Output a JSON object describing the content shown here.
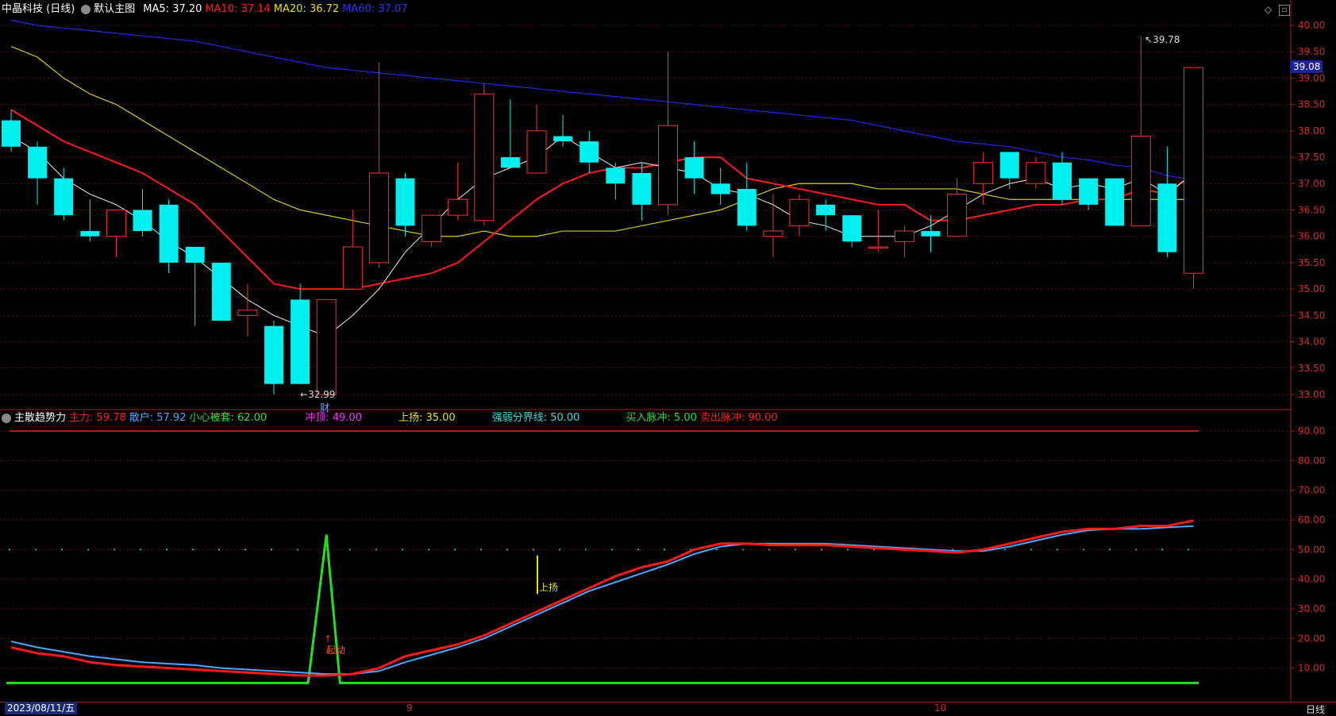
{
  "main_header": {
    "stock": "中晶科技 (日线)",
    "template": "默认主图",
    "ma5": {
      "label": "MA5: 37.20",
      "color": "#ffffff"
    },
    "ma10": {
      "label": "MA10: 37.14",
      "color": "#ff2020"
    },
    "ma20": {
      "label": "MA20: 36.72",
      "color": "#e8e000"
    },
    "ma60": {
      "label": "MA60: 37.07",
      "color": "#3030ff"
    }
  },
  "sub_header": {
    "title": "主散趋势力",
    "items": [
      {
        "label": "主力: 59.78",
        "color": "#ff2020"
      },
      {
        "label": "散户: 57.92",
        "color": "#4aa8ff"
      },
      {
        "label": "小心被套: 62.00",
        "color": "#30e030"
      },
      {
        "label": "冲顶: 49.00",
        "color": "#ff30ff"
      },
      {
        "label": "上扬: 35.00",
        "color": "#e8e000"
      },
      {
        "label": "强弱分界线: 50.00",
        "color": "#30e0e0"
      },
      {
        "label": "买入脉冲: 5.00",
        "color": "#30e030"
      },
      {
        "label": "卖出脉冲: 90.00",
        "color": "#ff2020"
      }
    ]
  },
  "price_axis": [
    "40.00",
    "39.50",
    "39.00",
    "38.50",
    "38.00",
    "37.50",
    "37.00",
    "36.50",
    "36.00",
    "35.50",
    "35.00",
    "34.50",
    "34.00",
    "33.50",
    "33.00"
  ],
  "indicator_axis": [
    "90.00",
    "80.00",
    "70.00",
    "60.00",
    "50.00",
    "40.00",
    "30.00",
    "20.00",
    "10.00"
  ],
  "current_price_flag": "39.08",
  "max_label": "39.78",
  "min_label": "32.99",
  "event_marker": "财",
  "signal_labels": {
    "start": "起动",
    "rise": "上扬"
  },
  "bottom_bar": {
    "date": "2023/08/11/五",
    "month1": "9",
    "month2": "10",
    "period": "日线"
  },
  "chart_data": {
    "type": "candlestick",
    "ylim": [
      32.8,
      40.2
    ],
    "candles": [
      [
        38.2,
        37.7,
        38.4,
        37.6
      ],
      [
        37.7,
        37.1,
        37.8,
        36.6
      ],
      [
        37.1,
        36.4,
        37.3,
        36.3
      ],
      [
        36.1,
        36.0,
        36.7,
        35.9
      ],
      [
        36.0,
        36.5,
        36.5,
        35.6
      ],
      [
        36.5,
        36.1,
        36.9,
        36.0
      ],
      [
        36.6,
        35.5,
        36.7,
        35.3
      ],
      [
        35.8,
        35.5,
        35.8,
        34.3
      ],
      [
        35.5,
        34.4,
        35.5,
        34.4
      ],
      [
        34.5,
        34.6,
        35.1,
        34.1
      ],
      [
        34.3,
        33.2,
        34.4,
        33.0
      ],
      [
        34.8,
        33.2,
        35.1,
        33.2
      ],
      [
        33.0,
        34.8,
        34.8,
        32.99
      ],
      [
        35.0,
        35.8,
        36.5,
        35.0
      ],
      [
        35.5,
        37.2,
        39.3,
        35.4
      ],
      [
        37.1,
        36.2,
        37.2,
        36.0
      ],
      [
        35.9,
        36.4,
        36.4,
        35.8
      ],
      [
        36.4,
        36.7,
        37.4,
        36.3
      ],
      [
        36.3,
        38.7,
        38.9,
        36.2
      ],
      [
        37.5,
        37.3,
        38.6,
        37.3
      ],
      [
        37.2,
        38.0,
        38.5,
        37.2
      ],
      [
        37.9,
        37.8,
        38.3,
        37.7
      ],
      [
        37.8,
        37.4,
        38.0,
        37.2
      ],
      [
        37.3,
        37.0,
        37.4,
        36.7
      ],
      [
        37.2,
        36.6,
        37.4,
        36.3
      ],
      [
        36.6,
        38.1,
        39.5,
        36.4
      ],
      [
        37.5,
        37.1,
        37.8,
        36.8
      ],
      [
        37.0,
        36.8,
        37.3,
        36.6
      ],
      [
        36.9,
        36.2,
        37.4,
        36.1
      ],
      [
        36.0,
        36.1,
        36.8,
        35.6
      ],
      [
        36.2,
        36.7,
        36.8,
        36.0
      ],
      [
        36.6,
        36.4,
        36.7,
        36.1
      ],
      [
        36.4,
        35.9,
        36.4,
        35.8
      ],
      [
        35.8,
        35.8,
        36.5,
        35.7
      ],
      [
        35.9,
        36.1,
        36.2,
        35.6
      ],
      [
        36.1,
        36.0,
        36.4,
        35.7
      ],
      [
        36.0,
        36.8,
        37.1,
        36.0
      ],
      [
        37.0,
        37.4,
        37.6,
        36.6
      ],
      [
        37.6,
        37.1,
        37.6,
        36.9
      ],
      [
        37.0,
        37.4,
        37.5,
        36.9
      ],
      [
        37.4,
        36.7,
        37.6,
        36.6
      ],
      [
        37.1,
        36.6,
        37.1,
        36.5
      ],
      [
        37.1,
        36.2,
        37.1,
        36.2
      ],
      [
        36.2,
        37.9,
        39.8,
        36.2
      ],
      [
        37.0,
        35.7,
        37.7,
        35.6
      ],
      [
        35.3,
        39.2,
        39.2,
        35.0
      ]
    ],
    "ma5": [
      37.9,
      37.6,
      37.1,
      36.8,
      36.6,
      36.3,
      35.9,
      35.6,
      35.2,
      34.8,
      34.5,
      34.3,
      34.1,
      34.5,
      35.0,
      35.7,
      36.2,
      36.7,
      37.1,
      37.3,
      37.5,
      37.9,
      37.6,
      37.3,
      37.4,
      37.3,
      37.2,
      36.9,
      36.8,
      36.6,
      36.3,
      36.2,
      36.0,
      36.0,
      36.0,
      36.2,
      36.5,
      36.8,
      37.0,
      37.1,
      36.9,
      37.0,
      36.9,
      37.1,
      36.8,
      37.2
    ],
    "ma10": [
      38.4,
      38.1,
      37.8,
      37.6,
      37.4,
      37.2,
      36.9,
      36.6,
      36.1,
      35.6,
      35.1,
      35.0,
      35.0,
      35.0,
      35.1,
      35.2,
      35.3,
      35.5,
      35.9,
      36.3,
      36.7,
      37.0,
      37.2,
      37.3,
      37.3,
      37.4,
      37.5,
      37.5,
      37.1,
      37.0,
      36.9,
      36.8,
      36.7,
      36.6,
      36.6,
      36.3,
      36.3,
      36.4,
      36.5,
      36.6,
      36.6,
      36.7,
      36.7,
      36.9,
      36.8,
      37.2
    ],
    "ma20": [
      39.6,
      39.4,
      39.0,
      38.7,
      38.5,
      38.2,
      37.9,
      37.6,
      37.3,
      37.0,
      36.7,
      36.5,
      36.4,
      36.3,
      36.2,
      36.1,
      36.0,
      36.0,
      36.1,
      36.0,
      36.0,
      36.1,
      36.1,
      36.1,
      36.2,
      36.3,
      36.4,
      36.5,
      36.7,
      36.9,
      37.0,
      37.0,
      37.0,
      36.9,
      36.9,
      36.9,
      36.9,
      36.8,
      36.7,
      36.7,
      36.7,
      36.7,
      36.7,
      36.7,
      36.7,
      36.7
    ],
    "ma60": [
      40.1,
      40.0,
      39.95,
      39.9,
      39.85,
      39.8,
      39.75,
      39.7,
      39.6,
      39.5,
      39.4,
      39.3,
      39.2,
      39.15,
      39.1,
      39.05,
      39.0,
      38.95,
      38.9,
      38.85,
      38.8,
      38.75,
      38.7,
      38.65,
      38.6,
      38.55,
      38.5,
      38.45,
      38.4,
      38.35,
      38.3,
      38.25,
      38.2,
      38.1,
      38.0,
      37.9,
      37.8,
      37.75,
      37.7,
      37.6,
      37.5,
      37.45,
      37.35,
      37.3,
      37.15,
      37.07
    ],
    "indicator": {
      "ylim": [
        0,
        100
      ],
      "main_force": [
        17,
        15,
        14,
        12,
        11,
        10.5,
        10,
        9.5,
        9,
        8.5,
        8,
        7.5,
        7.5,
        8,
        10,
        14,
        16,
        18,
        21,
        25,
        29,
        33,
        37,
        41,
        44,
        46,
        50,
        52,
        52,
        51.5,
        51.5,
        51.5,
        51,
        50.5,
        50,
        49.5,
        49,
        50,
        52,
        54,
        56,
        57,
        57,
        58,
        58,
        59.78
      ],
      "retail": [
        19,
        17,
        15.5,
        14,
        13,
        12,
        11.5,
        11,
        10,
        9.5,
        9,
        8.5,
        8,
        8,
        9,
        12,
        14.5,
        17,
        20,
        24,
        28,
        32,
        36,
        39,
        42,
        45,
        48.5,
        51,
        52,
        52,
        52,
        52,
        51.5,
        51,
        50.5,
        50,
        49.5,
        49.5,
        51,
        53,
        55,
        56.5,
        57,
        57,
        57.5,
        57.92
      ],
      "pulse": [
        5,
        5,
        5,
        5,
        5,
        5,
        5,
        5,
        5,
        5,
        5,
        5,
        55,
        5,
        5,
        5,
        5,
        5,
        5,
        5,
        5,
        5,
        5,
        5,
        5,
        5,
        5,
        5,
        5,
        5,
        5,
        5,
        5,
        5,
        5,
        5,
        5,
        5,
        5,
        5,
        5,
        5,
        5,
        5,
        5,
        5
      ],
      "sell_line": 90,
      "threshold": 50
    }
  }
}
